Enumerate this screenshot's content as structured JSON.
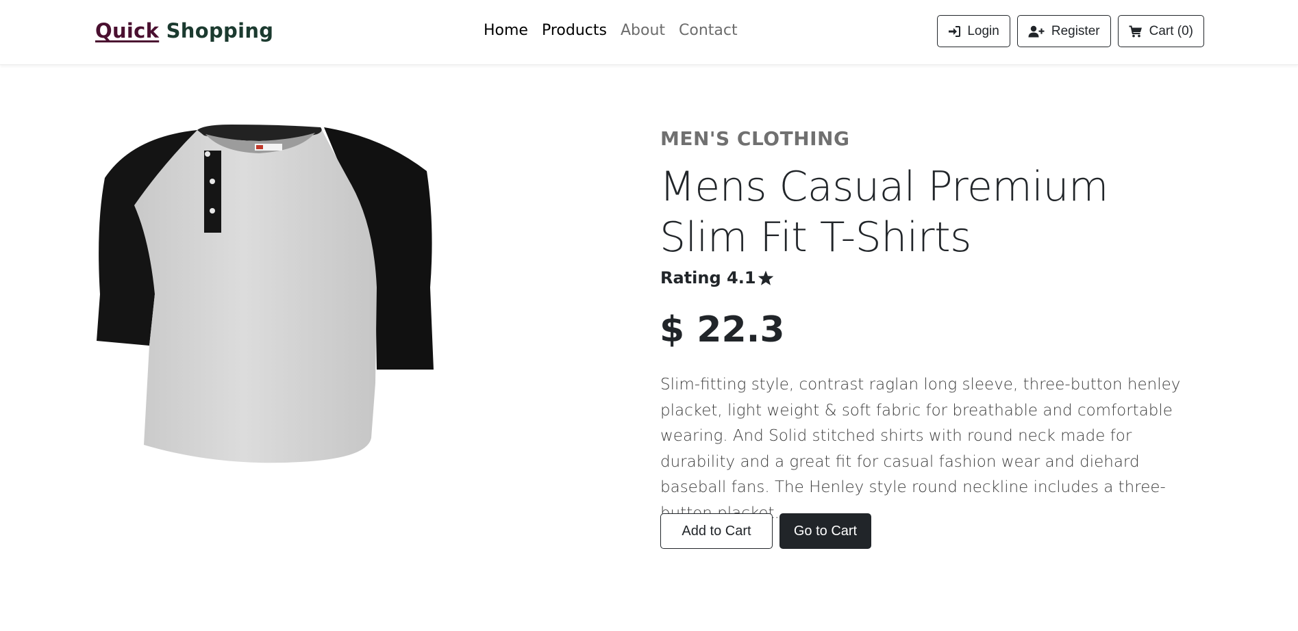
{
  "nav": {
    "brand_first": "Quick",
    "brand_second": "Shopping",
    "links": [
      "Home",
      "Products",
      "About",
      "Contact"
    ],
    "login_label": "Login",
    "register_label": "Register",
    "cart_label": "Cart (0)"
  },
  "product": {
    "category": "MEN'S CLOTHING",
    "title": "Mens Casual Premium Slim Fit T-Shirts",
    "rating_label": "Rating 4.1",
    "price_label": "$ 22.3",
    "description": "Slim-fitting style, contrast raglan long sleeve, three-button henley placket, light weight & soft fabric for breathable and comfortable wearing. And Solid stitched shirts with round neck made for durability and a great fit for casual fashion wear and diehard baseball fans. The Henley style round neckline includes a three-button placket.",
    "add_to_cart_label": "Add to Cart",
    "go_to_cart_label": "Go to Cart"
  },
  "icons": {
    "login": "sign-in-icon",
    "register": "user-plus-icon",
    "cart": "shopping-cart-icon",
    "rating": "star-icon"
  },
  "colors": {
    "brand_first": "#4a1030",
    "brand_second": "#1b3a2f",
    "dark": "#212529",
    "muted": "#707070"
  }
}
